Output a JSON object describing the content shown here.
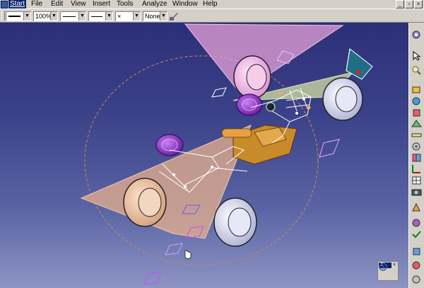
{
  "menu": {
    "start": "Start",
    "file": "File",
    "edit": "Edit",
    "view": "View",
    "insert": "Insert",
    "tools": "Tools",
    "analyze": "Analyze",
    "window": "Window",
    "help": "Help"
  },
  "toolbar": {
    "zoom": "100%",
    "point_style": "×",
    "layer": "None"
  },
  "mini_toolbar": {
    "title": "T",
    "close": "×"
  },
  "colors": {
    "viewport_top": "#2c2f78",
    "viewport_bottom": "#8d94c4",
    "menu_highlight": "#0a246a",
    "plane_pink": "#e7a2d9",
    "plane_orange": "#e8b08c",
    "plane_green": "#c9d4a0",
    "wheel_gray": "#c9cbe6",
    "wheel_purple": "#8a2cc4",
    "bracket_orange": "#c98a2a"
  },
  "icons": [
    "gear-icon",
    "cursor-icon",
    "search-icon",
    "sketch-icon",
    "sphere-icon",
    "cube-icon",
    "plane-icon",
    "ruler-icon",
    "wheel-icon",
    "link-icon",
    "axis-icon",
    "grid-icon",
    "camera-icon",
    "measure-icon",
    "swirl-icon",
    "check-icon"
  ]
}
